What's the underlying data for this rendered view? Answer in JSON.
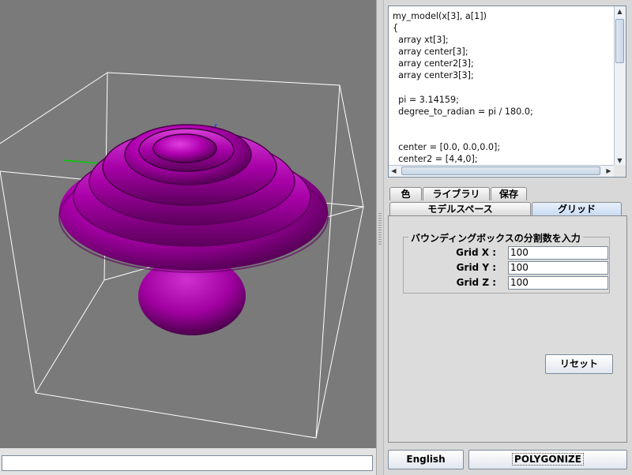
{
  "code": {
    "lines": [
      "my_model(x[3], a[1])",
      "{",
      "  array xt[3];",
      "  array center[3];",
      "  array center2[3];",
      "  array center3[3];",
      "",
      "  pi = 3.14159;",
      "  degree_to_radian = pi / 180.0;",
      "",
      "",
      "  center = [0.0, 0.0,0.0];",
      "  center2 = [4,4,0];"
    ]
  },
  "tabs": {
    "row1": [
      "色",
      "ライブラリ",
      "保存"
    ],
    "row2": [
      "モデルスペース",
      "グリッド"
    ],
    "selected": "グリッド"
  },
  "grid_panel": {
    "legend": "バウンディングボックスの分割数を入力",
    "fields": [
      {
        "label": "Grid X :",
        "value": "100"
      },
      {
        "label": "Grid Y :",
        "value": "100"
      },
      {
        "label": "Grid Z :",
        "value": "100"
      }
    ],
    "reset_label": "リセット"
  },
  "bottom": {
    "language_label": "English",
    "polygonize_label": "POLYGONIZE"
  },
  "colors": {
    "viewport_bg": "#7a7a7a",
    "model": "#b000b0",
    "axis_x": "#00cc00",
    "axis_y": "#3333ff",
    "bbox": "#ffffff"
  },
  "scrollbars": {
    "up_icon": "arrow-up-icon",
    "down_icon": "arrow-down-icon",
    "left_icon": "arrow-left-icon",
    "right_icon": "arrow-right-icon"
  }
}
